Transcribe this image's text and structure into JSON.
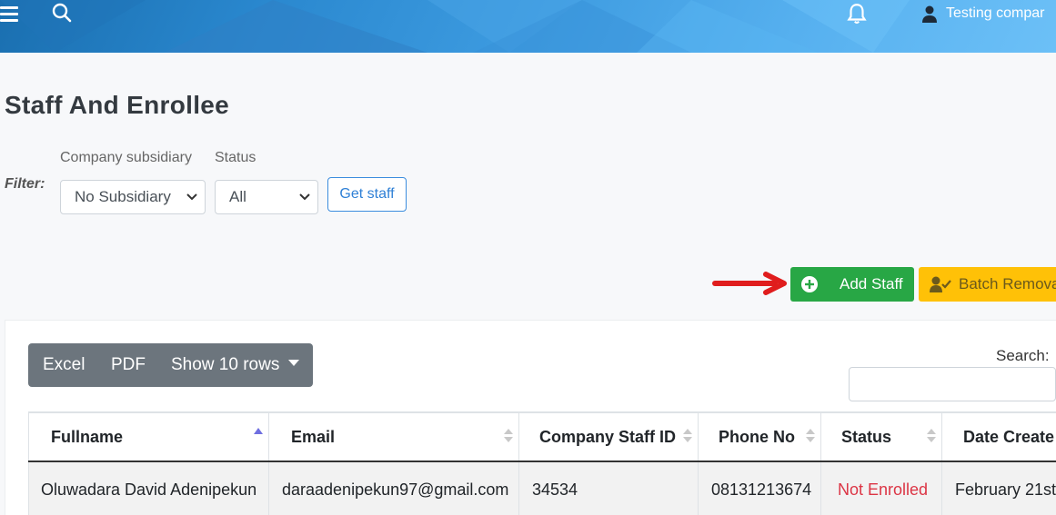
{
  "header": {
    "user_name": "Testing compar",
    "icons": [
      "hamburger-menu-icon",
      "search-icon",
      "bell-icon",
      "user-icon"
    ]
  },
  "page": {
    "title": "Staff And Enrollee"
  },
  "filter": {
    "label": "Filter:",
    "subsidiary_label": "Company subsidiary",
    "subsidiary_value": "No Subsidiary",
    "status_label": "Status",
    "status_value": "All",
    "get_button": "Get staff"
  },
  "actions": {
    "add_staff": "Add Staff",
    "batch_removal": "Batch Remova",
    "colors": {
      "add": "#28a745",
      "batch": "#ffc107",
      "arrow": "#e01d1d"
    }
  },
  "toolbar": {
    "excel": "Excel",
    "pdf": "PDF",
    "show_rows": "Show 10 rows",
    "search_label": "Search:"
  },
  "table": {
    "columns": [
      "Fullname",
      "Email",
      "Company Staff ID",
      "Phone No",
      "Status",
      "Date Create"
    ],
    "rows": [
      {
        "fullname": "Oluwadara David Adenipekun",
        "email": "daraadenipekun97@gmail.com",
        "staff_id": "34534",
        "phone": "08131213674",
        "status": "Not Enrolled",
        "date": "February 21st"
      }
    ],
    "status_color": "#dc3545"
  }
}
